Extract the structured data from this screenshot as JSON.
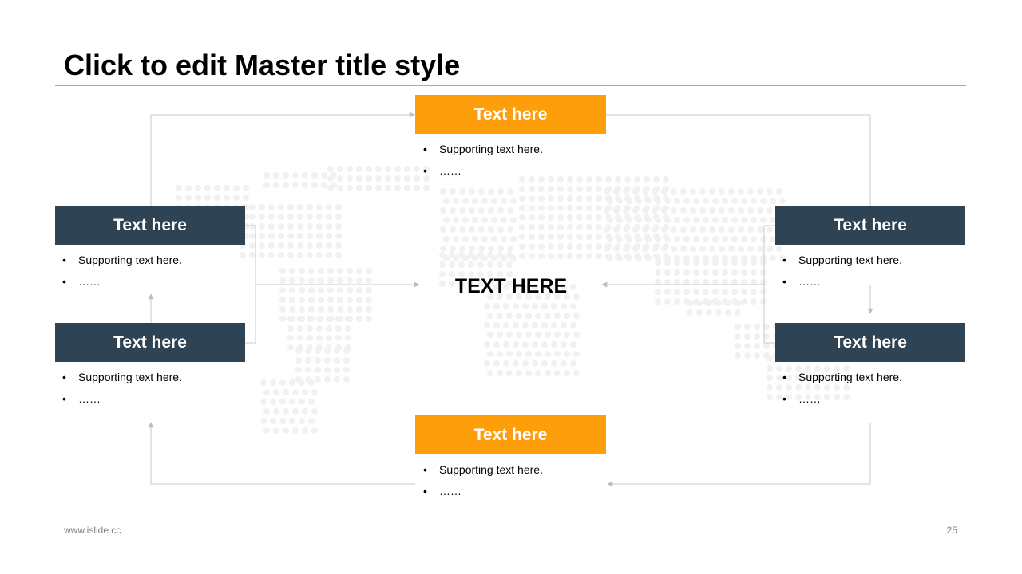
{
  "slide": {
    "title": "Click to edit Master title style",
    "center_text": "TEXT HERE",
    "footer_url": "www.islide.cc",
    "page_number": "25"
  },
  "colors": {
    "orange": "#ff9e0b",
    "dark_blue": "#2e4353",
    "connector": "#c8c8c8",
    "map_dots": "#f1f1f1"
  },
  "nodes": {
    "top": {
      "title": "Text here",
      "bullets": [
        "Supporting text here.",
        "……"
      ]
    },
    "left_upper": {
      "title": "Text here",
      "bullets": [
        "Supporting text here.",
        "……"
      ]
    },
    "left_lower": {
      "title": "Text here",
      "bullets": [
        "Supporting text here.",
        "……"
      ]
    },
    "right_upper": {
      "title": "Text here",
      "bullets": [
        "Supporting text here.",
        "……"
      ]
    },
    "right_lower": {
      "title": "Text here",
      "bullets": [
        "Supporting text here.",
        "……"
      ]
    },
    "bottom": {
      "title": "Text here",
      "bullets": [
        "Supporting text here.",
        "……"
      ]
    }
  }
}
